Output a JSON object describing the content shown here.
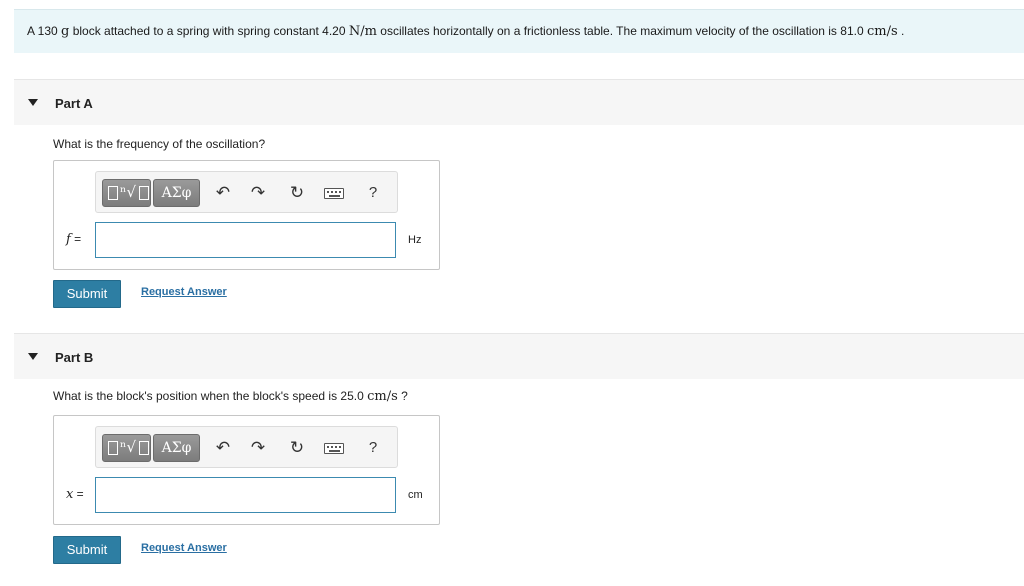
{
  "problem": {
    "text_a": "A 130 ",
    "mass_unit": "g",
    "text_b": " block attached to a spring with spring constant 4.20 ",
    "k_unit": "N/m",
    "text_c": " oscillates horizontally on a frictionless table.  The maximum velocity of the oscillation is 81.0 ",
    "v_unit": "cm/s",
    "text_d": " ."
  },
  "parts": [
    {
      "title": "Part A",
      "question_a": "What is the frequency of the oscillation?",
      "question_unit": "",
      "question_b": "",
      "variable": "f",
      "equals": " =",
      "input_value": "",
      "unit": "Hz",
      "submit_label": "Submit",
      "request_label": "Request Answer"
    },
    {
      "title": "Part B",
      "question_a": "What is the block's position when the block's speed is 25.0 ",
      "question_unit": "cm/s",
      "question_b": " ?",
      "variable": "x",
      "equals": " =",
      "input_value": "",
      "unit": "cm",
      "submit_label": "Submit",
      "request_label": "Request Answer"
    }
  ],
  "toolbar": {
    "templates_icon": "templates-icon",
    "greek_label": "ΑΣφ",
    "undo_icon": "undo-icon",
    "redo_icon": "redo-icon",
    "reset_icon": "reset-icon",
    "keyboard_icon": "keyboard-icon",
    "help_label": "?"
  },
  "colors": {
    "problem_bg": "#eaf6f9",
    "submit_bg": "#2d7ea3",
    "link": "#2a6fa3",
    "input_border": "#3c8ab0"
  }
}
